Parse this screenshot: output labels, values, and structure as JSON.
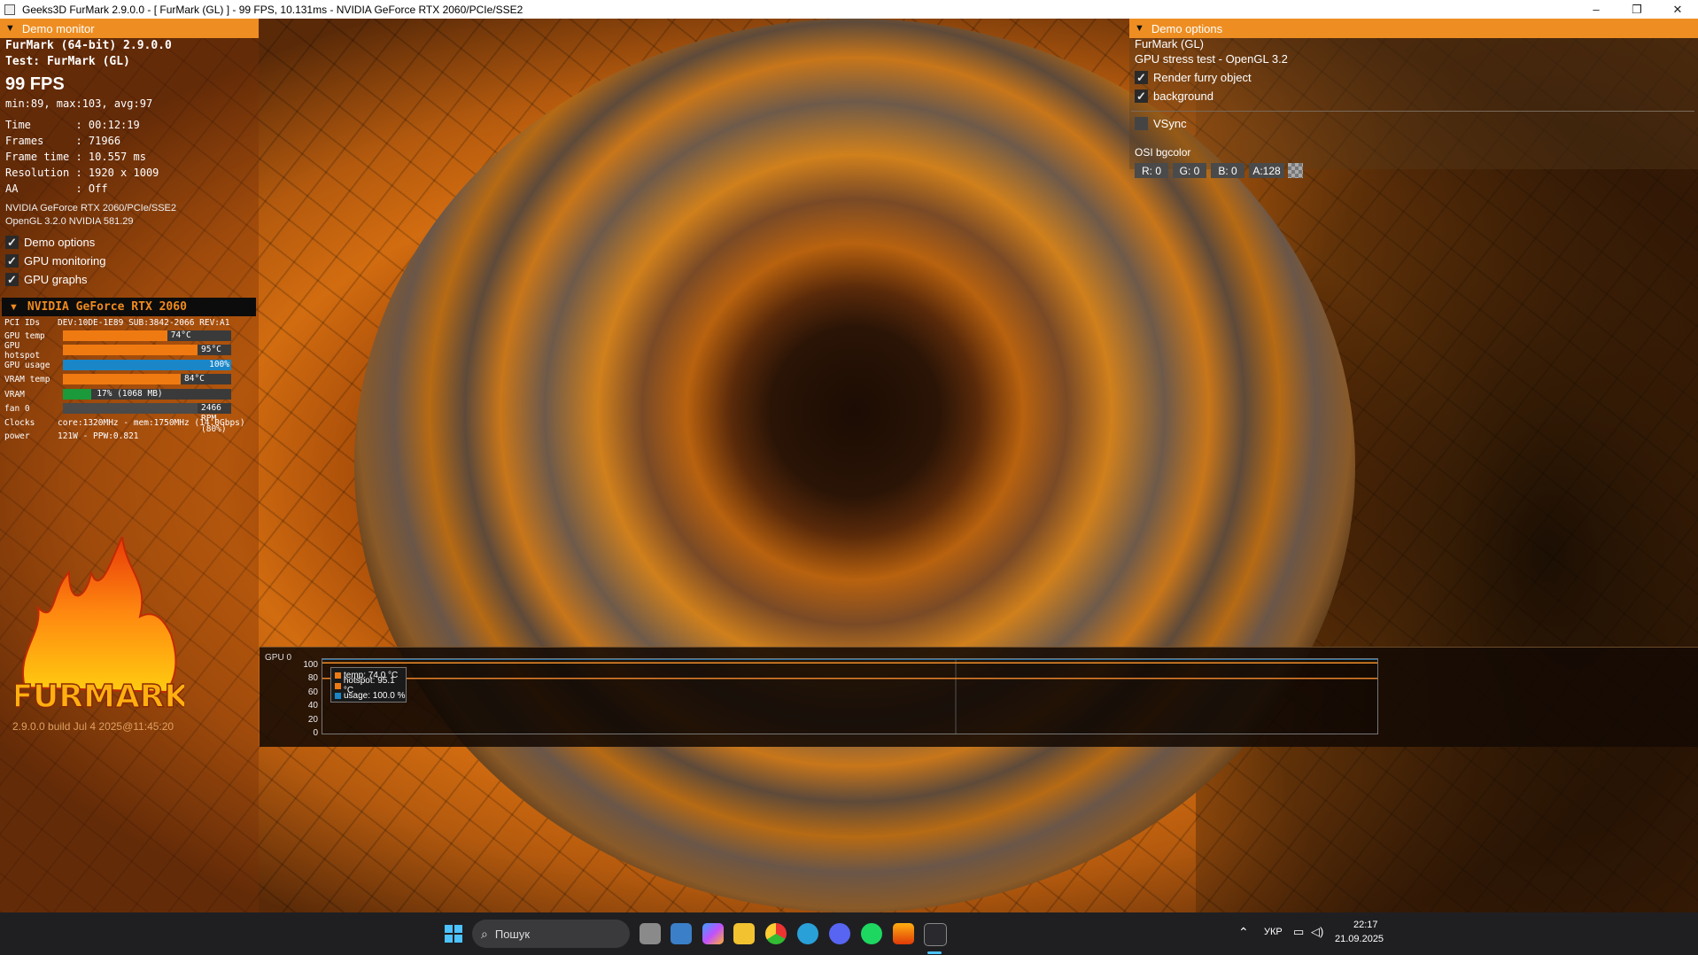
{
  "window": {
    "title": "Geeks3D FurMark 2.9.0.0 - [ FurMark (GL) ] - 99 FPS, 10.131ms - NVIDIA GeForce RTX 2060/PCIe/SSE2",
    "minimize": "–",
    "maximize": "❐",
    "close": "✕"
  },
  "demo_monitor": {
    "header": "Demo monitor",
    "app_name": "FurMark (64-bit) 2.9.0.0",
    "test": "Test: FurMark (GL)",
    "fps": "99 FPS",
    "fps_stats": "min:89, max:103, avg:97",
    "time": "Time       : 00:12:19",
    "frames": "Frames     : 71966",
    "frame_time": "Frame time : 10.557 ms",
    "resolution": "Resolution : 1920 x 1009",
    "aa": "AA         : Off",
    "renderer": "NVIDIA GeForce RTX 2060/PCIe/SSE2",
    "opengl": "OpenGL 3.2.0 NVIDIA 581.29",
    "checks": [
      {
        "label": "Demo options",
        "checked": true
      },
      {
        "label": "GPU monitoring",
        "checked": true
      },
      {
        "label": "GPU graphs",
        "checked": true
      }
    ]
  },
  "gpu_monitor": {
    "header": "NVIDIA GeForce RTX 2060",
    "pci_label": "PCI IDs",
    "pci_value": "DEV:10DE-1E89 SUB:3842-2066 REV:A1",
    "rows": [
      {
        "label": "GPU temp",
        "value_text": "74°C",
        "fill_fraction": 0.62,
        "color": "#f07a12"
      },
      {
        "label": "GPU hotspot",
        "value_text": "95°C",
        "fill_fraction": 0.8,
        "color": "#f07a12"
      },
      {
        "label": "GPU usage",
        "value_text": "100%",
        "fill_fraction": 1.0,
        "color": "#1a86c8"
      },
      {
        "label": "VRAM temp",
        "value_text": "84°C",
        "fill_fraction": 0.7,
        "color": "#f07a12"
      },
      {
        "label": "VRAM",
        "value_text": "17% (1068 MB)",
        "fill_fraction": 0.17,
        "color": "#1a9a3a"
      },
      {
        "label": "fan 0",
        "value_text": "2466 RPM (80%)",
        "fill_fraction": 0.8,
        "color": "#4a4a4a"
      }
    ],
    "clocks_label": "Clocks",
    "clocks_value": "core:1320MHz - mem:1750MHz (14.0Gbps)",
    "power_label": "power",
    "power_value": "121W - PPW:0.821"
  },
  "logo": {
    "text": "FURMARK"
  },
  "build": "2.9.0.0 build Jul  4 2025@11:45:20",
  "demo_options": {
    "header": "Demo options",
    "name": "FurMark (GL)",
    "description": "GPU stress test - OpenGL 3.2",
    "render_furry": {
      "label": "Render furry object",
      "checked": true
    },
    "background": {
      "label": "background",
      "checked": true
    },
    "vsync": {
      "label": "VSync",
      "checked": false
    },
    "osi_bgcolor": "OSI bgcolor",
    "color_fields": [
      "R: 0",
      "G: 0",
      "B: 0",
      "A:128"
    ]
  },
  "graph": {
    "label": "GPU 0",
    "yticks": [
      "100",
      "80",
      "60",
      "40",
      "20",
      "0"
    ],
    "legend": [
      {
        "text": "temp: 74.0 °C",
        "color": "#f07a12"
      },
      {
        "text": "hotspot: 95.1 °C",
        "color": "#f07a12"
      },
      {
        "text": "usage: 100.0 %",
        "color": "#1a86c8"
      }
    ]
  },
  "chart_data": {
    "type": "line",
    "ylim": [
      0,
      100
    ],
    "series": [
      {
        "name": "temp",
        "values": [
          74,
          74,
          74,
          74,
          74,
          74,
          74,
          74,
          74,
          74,
          74,
          74
        ]
      },
      {
        "name": "hotspot",
        "values": [
          95,
          95,
          95,
          95,
          95,
          95,
          95,
          95,
          95,
          95,
          95,
          95
        ]
      },
      {
        "name": "usage",
        "values": [
          100,
          100,
          100,
          100,
          100,
          100,
          100,
          100,
          100,
          100,
          100,
          100
        ]
      }
    ]
  },
  "taskbar": {
    "search_placeholder": "Пошук",
    "language": "УКР",
    "time": "22:17",
    "date": "21.09.2025"
  }
}
